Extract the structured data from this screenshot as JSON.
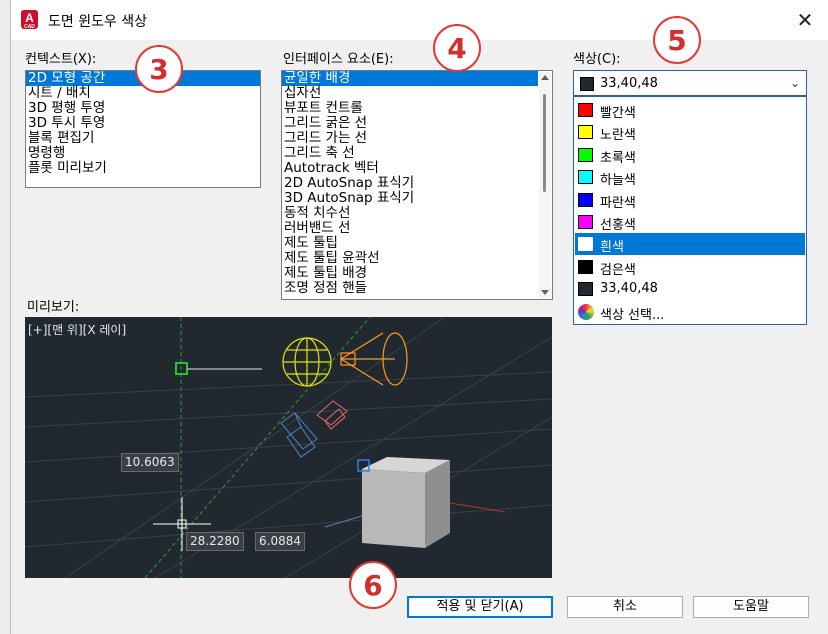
{
  "window": {
    "title": "도면 윈도우 색상",
    "close_glyph": "✕"
  },
  "context": {
    "label": "컨텍스트(X):",
    "items": [
      "2D 모형 공간",
      "시트 / 배치",
      "3D 평행 투영",
      "3D 투시 투영",
      "블록 편집기",
      "명령행",
      "플롯 미리보기"
    ],
    "selected": 0
  },
  "interface": {
    "label": "인터페이스 요소(E):",
    "items": [
      "균일한 배경",
      "십자선",
      "뷰포트 컨트롤",
      "그리드 굵은 선",
      "그리드 가는 선",
      "그리드 축 선",
      "Autotrack 벡터",
      "2D AutoSnap 표식기",
      "3D AutoSnap 표식기",
      "동적 치수선",
      "러버밴드 선",
      "제도 툴팁",
      "제도 툴팁 윤곽선",
      "제도 툴팁 배경",
      "조명 정점 핸들"
    ],
    "selected": 0
  },
  "color": {
    "label": "색상(C):",
    "current": "33,40,48",
    "current_swatch": "#21282f",
    "options": [
      {
        "label": "빨간색",
        "swatch": "#ff0000"
      },
      {
        "label": "노란색",
        "swatch": "#ffff00"
      },
      {
        "label": "초록색",
        "swatch": "#00ff00"
      },
      {
        "label": "하늘색",
        "swatch": "#00ffff"
      },
      {
        "label": "파란색",
        "swatch": "#0000ff"
      },
      {
        "label": "선홍색",
        "swatch": "#ff00ff"
      },
      {
        "label": "흰색",
        "swatch": "#ffffff"
      },
      {
        "label": "검은색",
        "swatch": "#000000"
      },
      {
        "label": "33,40,48",
        "swatch": "#21282f"
      },
      {
        "label": "색상 선택...",
        "swatch": "wheel"
      }
    ],
    "selected_option": 6
  },
  "preview": {
    "label": "미리보기:",
    "viewport_label": "[+][맨 위][X 레이]",
    "dim_value": "10.6063",
    "coord_x": "28.2280",
    "coord_y": "6.0884",
    "background": "#212830"
  },
  "buttons": {
    "apply": "적용 및 닫기(A)",
    "cancel": "취소",
    "help": "도움말"
  },
  "callouts": [
    "3",
    "4",
    "5",
    "6"
  ]
}
